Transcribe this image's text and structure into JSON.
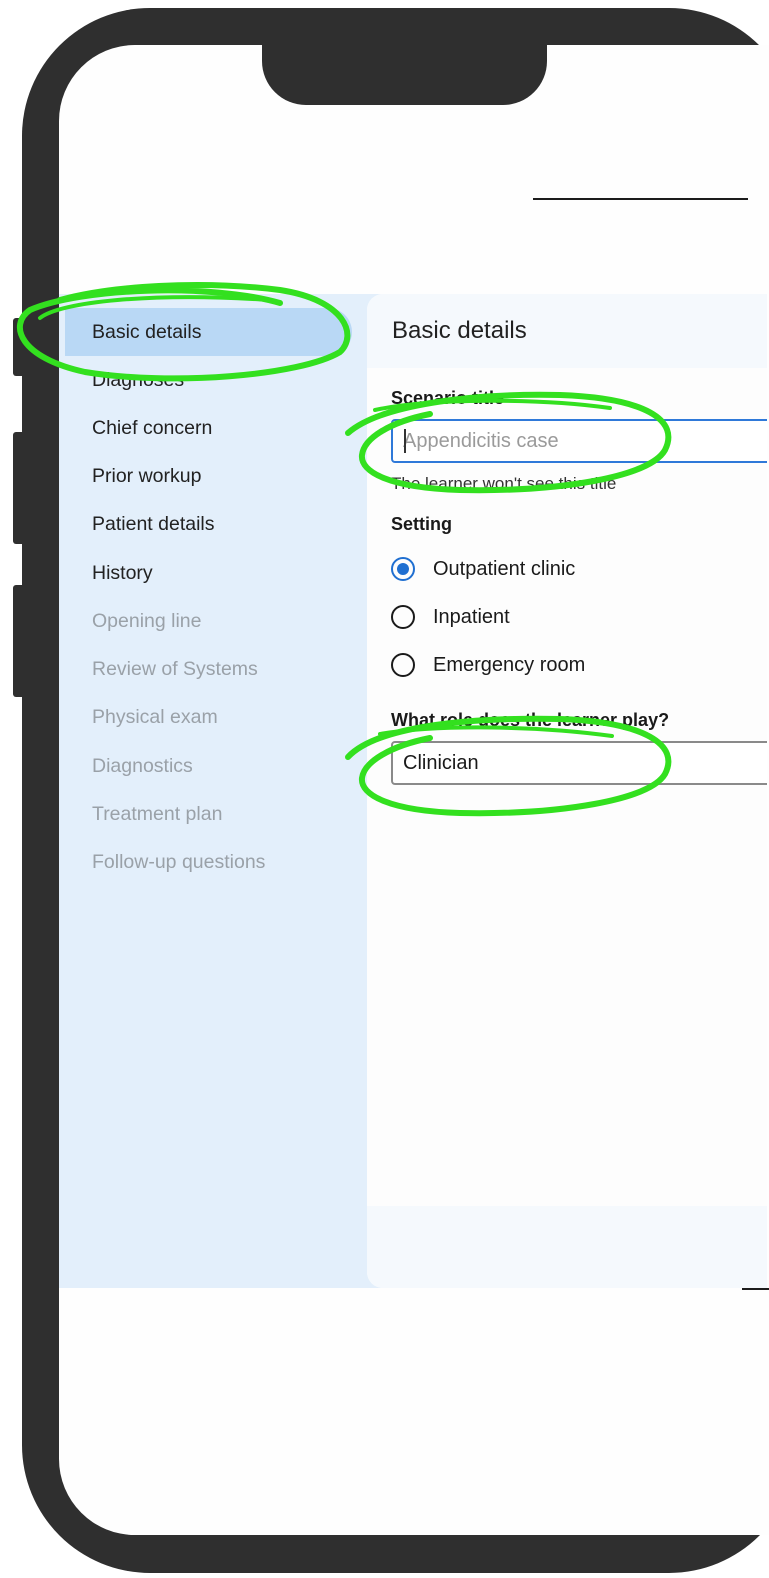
{
  "sidebar": {
    "items": [
      {
        "label": "Basic details",
        "state": "active"
      },
      {
        "label": "Diagnoses",
        "state": "enabled"
      },
      {
        "label": "Chief concern",
        "state": "enabled"
      },
      {
        "label": "Prior workup",
        "state": "enabled"
      },
      {
        "label": "Patient details",
        "state": "enabled"
      },
      {
        "label": "History",
        "state": "enabled"
      },
      {
        "label": "Opening line",
        "state": "disabled"
      },
      {
        "label": "Review of Systems",
        "state": "disabled"
      },
      {
        "label": "Physical exam",
        "state": "disabled"
      },
      {
        "label": "Diagnostics",
        "state": "disabled"
      },
      {
        "label": "Treatment plan",
        "state": "disabled"
      },
      {
        "label": "Follow-up questions",
        "state": "disabled"
      }
    ]
  },
  "main": {
    "title": "Basic details",
    "scenario_title": {
      "label": "Scenario title",
      "placeholder": "Appendicitis case",
      "value": "",
      "helper": "The learner won't see this title"
    },
    "setting": {
      "label": "Setting",
      "options": [
        {
          "label": "Outpatient clinic",
          "checked": true
        },
        {
          "label": "Inpatient",
          "checked": false
        },
        {
          "label": "Emergency room",
          "checked": false
        }
      ]
    },
    "role": {
      "label": "What role does the learner play?",
      "value": "Clinician"
    }
  },
  "colors": {
    "accent": "#1f6fd1",
    "focus_border": "#2f79d9",
    "sidebar_bg": "#e3effb",
    "active_pill": "#b9d8f5",
    "highlight_marker": "#33e01f",
    "phone_frame": "#2f2f2f"
  }
}
